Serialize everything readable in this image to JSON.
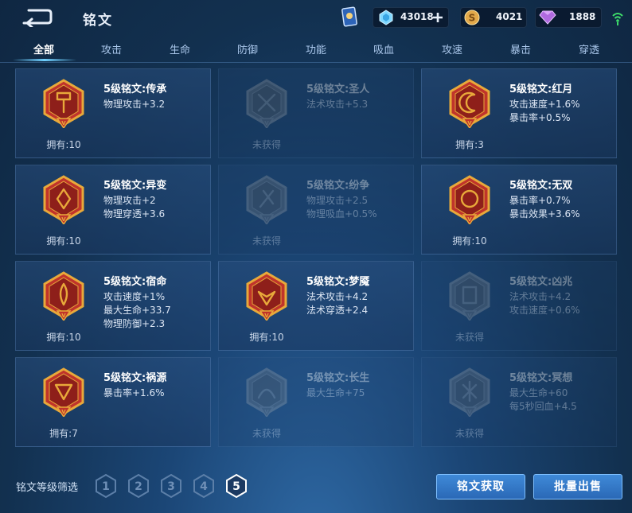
{
  "header": {
    "title": "铭文",
    "resources": [
      {
        "icon": "diamond-icon",
        "value": "43018"
      },
      {
        "icon": "gold-coin-icon",
        "value": "4021"
      },
      {
        "icon": "gem-icon",
        "value": "1888"
      }
    ]
  },
  "tabs": [
    "全部",
    "攻击",
    "生命",
    "防御",
    "功能",
    "吸血",
    "攻速",
    "暴击",
    "穿透"
  ],
  "active_tab": "全部",
  "cards": [
    {
      "name": "5级铭文:传承",
      "stats": [
        "物理攻击+3.2"
      ],
      "owned": "拥有:10",
      "locked": false,
      "icon": "chuancheng-emblem-icon"
    },
    {
      "name": "5级铭文:圣人",
      "stats": [
        "法术攻击+5.3"
      ],
      "owned": "未获得",
      "locked": true,
      "icon": "shengren-emblem-icon"
    },
    {
      "name": "5级铭文:红月",
      "stats": [
        "攻击速度+1.6%",
        "暴击率+0.5%"
      ],
      "owned": "拥有:3",
      "locked": false,
      "icon": "hongyue-emblem-icon"
    },
    {
      "name": "5级铭文:异变",
      "stats": [
        "物理攻击+2",
        "物理穿透+3.6"
      ],
      "owned": "拥有:10",
      "locked": false,
      "icon": "yibian-emblem-icon"
    },
    {
      "name": "5级铭文:纷争",
      "stats": [
        "物理攻击+2.5",
        "物理吸血+0.5%"
      ],
      "owned": "未获得",
      "locked": true,
      "icon": "fenzheng-emblem-icon"
    },
    {
      "name": "5级铭文:无双",
      "stats": [
        "暴击率+0.7%",
        "暴击效果+3.6%"
      ],
      "owned": "拥有:10",
      "locked": false,
      "icon": "wushuang-emblem-icon"
    },
    {
      "name": "5级铭文:宿命",
      "stats": [
        "攻击速度+1%",
        "最大生命+33.7",
        "物理防御+2.3"
      ],
      "owned": "拥有:10",
      "locked": false,
      "icon": "suming-emblem-icon"
    },
    {
      "name": "5级铭文:梦魇",
      "stats": [
        "法术攻击+4.2",
        "法术穿透+2.4"
      ],
      "owned": "拥有:10",
      "locked": false,
      "icon": "mengyan-emblem-icon"
    },
    {
      "name": "5级铭文:凶兆",
      "stats": [
        "法术攻击+4.2",
        "攻击速度+0.6%"
      ],
      "owned": "未获得",
      "locked": true,
      "icon": "xiongzhao-emblem-icon"
    },
    {
      "name": "5级铭文:祸源",
      "stats": [
        "暴击率+1.6%"
      ],
      "owned": "拥有:7",
      "locked": false,
      "icon": "huoyuan-emblem-icon"
    },
    {
      "name": "5级铭文:长生",
      "stats": [
        "最大生命+75"
      ],
      "owned": "未获得",
      "locked": true,
      "icon": "changsheng-emblem-icon"
    },
    {
      "name": "5级铭文:冥想",
      "stats": [
        "最大生命+60",
        "每5秒回血+4.5"
      ],
      "owned": "未获得",
      "locked": true,
      "icon": "mingxiang-emblem-icon"
    }
  ],
  "emblem_level_mark": "V",
  "footer": {
    "filter_label": "铭文等级筛选",
    "levels": [
      "1",
      "2",
      "3",
      "4",
      "5"
    ],
    "selected_level": "5",
    "obtain_button": "铭文获取",
    "sell_button": "批量出售"
  },
  "colors": {
    "accent": "#6fd0ff",
    "emblem_red": "#c0342b",
    "emblem_gold": "#e8a93a",
    "locked_gray": "#7a8593"
  }
}
